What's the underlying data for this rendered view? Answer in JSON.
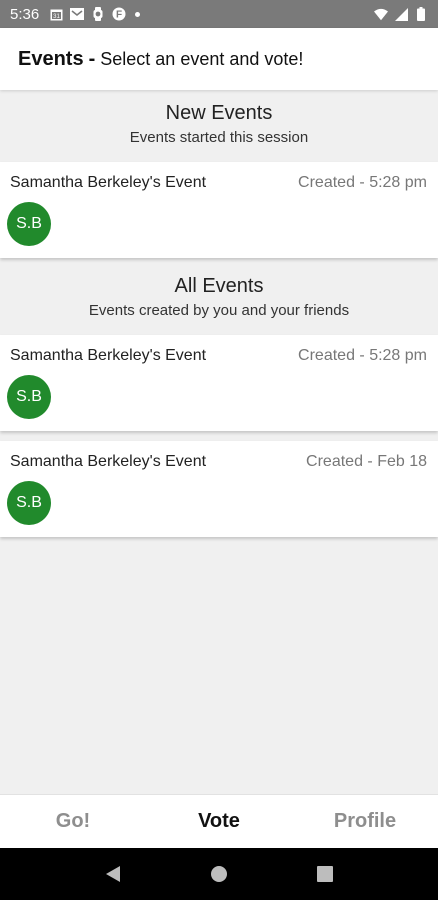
{
  "status_bar": {
    "time": "5:36",
    "left_icons": [
      "calendar-icon",
      "mail-icon",
      "watch-icon",
      "app-icon"
    ],
    "right_icons": [
      "wifi-icon",
      "signal-icon",
      "battery-icon"
    ]
  },
  "header": {
    "title": "Events",
    "separator": "-",
    "subtitle": "Select an event and vote!"
  },
  "sections": {
    "new": {
      "title": "New Events",
      "subtitle": "Events started this session",
      "events": [
        {
          "name": "Samantha Berkeley's Event",
          "created": "Created - 5:28 pm",
          "initials": "S.B"
        }
      ]
    },
    "all": {
      "title": "All Events",
      "subtitle": "Events created by you and your friends",
      "events": [
        {
          "name": "Samantha Berkeley's Event",
          "created": "Created - 5:28 pm",
          "initials": "S.B"
        },
        {
          "name": "Samantha Berkeley's Event",
          "created": "Created - Feb 18",
          "initials": "S.B"
        }
      ]
    }
  },
  "bottom_nav": {
    "tabs": [
      {
        "label": "Go!",
        "active": false
      },
      {
        "label": "Vote",
        "active": true
      },
      {
        "label": "Profile",
        "active": false
      }
    ]
  },
  "colors": {
    "avatar": "#218a2c",
    "status_bar": "#7a7a7a",
    "background": "#f0f0f0"
  }
}
